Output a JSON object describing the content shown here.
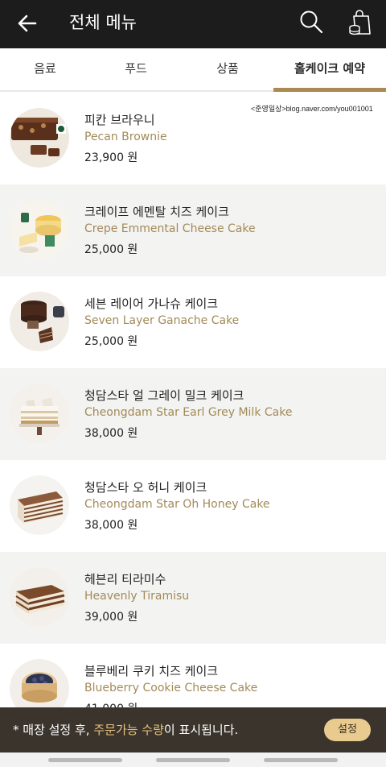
{
  "header": {
    "title": "전체 메뉴"
  },
  "tabs": [
    {
      "label": "음료"
    },
    {
      "label": "푸드"
    },
    {
      "label": "상품"
    },
    {
      "label": "홀케이크 예약"
    }
  ],
  "source_watermark": "<준영일상>blog.naver.com/you001001",
  "items": [
    {
      "name_ko": "피칸 브라우니",
      "name_en": "Pecan Brownie",
      "price": "23,900 원"
    },
    {
      "name_ko": "크레이프 에멘탈 치즈 케이크",
      "name_en": "Crepe Emmental Cheese Cake",
      "price": "25,000 원"
    },
    {
      "name_ko": "세븐 레이어 가나슈 케이크",
      "name_en": "Seven Layer Ganache Cake",
      "price": "25,000 원"
    },
    {
      "name_ko": "청담스타 얼 그레이 밀크 케이크",
      "name_en": "Cheongdam Star Earl Grey Milk Cake",
      "price": "38,000 원"
    },
    {
      "name_ko": "청담스타 오 허니 케이크",
      "name_en": "Cheongdam Star Oh Honey Cake",
      "price": "38,000 원"
    },
    {
      "name_ko": "헤븐리 티라미수",
      "name_en": "Heavenly Tiramisu",
      "price": "39,000 원"
    },
    {
      "name_ko": "블루베리 쿠키 치즈 케이크",
      "name_en": "Blueberry Cookie Cheese Cake",
      "price": "41,000 원"
    }
  ],
  "notice": {
    "prefix": "* 매장 설정 후, ",
    "highlight": "주문가능 수량",
    "suffix": "이 표시됩니다.",
    "button": "설정"
  },
  "colors": {
    "header_bg": "#1c1c1c",
    "accent_gold": "#a98a52",
    "english_name": "#a38a58",
    "notice_bg": "#3a342c",
    "notice_button": "#e9ca8f"
  }
}
